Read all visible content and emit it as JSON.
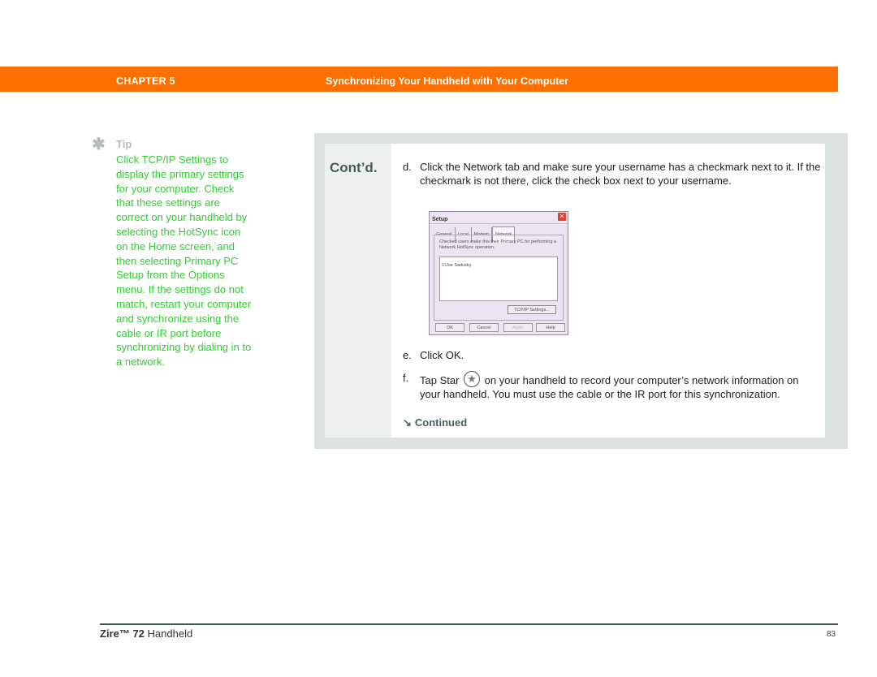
{
  "header": {
    "chapter": "CHAPTER 5",
    "title": "Synchronizing Your Handheld with Your Computer",
    "bar_color": "#ff6f00"
  },
  "tip": {
    "icon": "asterisk-icon",
    "title": "Tip",
    "body": "Click TCP/IP Settings to display the primary settings for your computer. Check that these settings are correct on your handheld by selecting the HotSync icon on the Home screen, and then selecting Primary PC Setup from the Options menu. If the settings do not match, restart your computer and synchronize using the cable or IR port before synchronizing by dialing in to a network."
  },
  "main": {
    "contd_label": "Cont’d.",
    "steps": [
      {
        "letter": "d.",
        "text": "Click the Network tab and make sure your username has a checkmark next to it. If the checkmark is not there, click the check box next to your username."
      },
      {
        "letter": "e.",
        "text": "Click OK."
      },
      {
        "letter": "f.",
        "text_before": "Tap Star",
        "text_after": "on your handheld to record your computer’s network information on your handheld. You must use the cable or the IR port for this synchronization."
      }
    ],
    "continued_label": "Continued"
  },
  "dialog": {
    "title": "Setup",
    "close": "✕",
    "tabs": [
      "General",
      "Local",
      "Modem",
      "Network"
    ],
    "active_tab": "Network",
    "description": "Checked users make this their Primary PC for performing a Network HotSync operation.",
    "list_items": [
      {
        "checked": true,
        "label": "Joe Sadusky"
      }
    ],
    "tcp_button": "TCP/IP Settings...",
    "buttons": [
      "OK",
      "Cancel",
      "Apply",
      "Help"
    ]
  },
  "footer": {
    "product_bold": "Zire™ 72",
    "product_rest": " Handheld",
    "page_number": "83"
  }
}
